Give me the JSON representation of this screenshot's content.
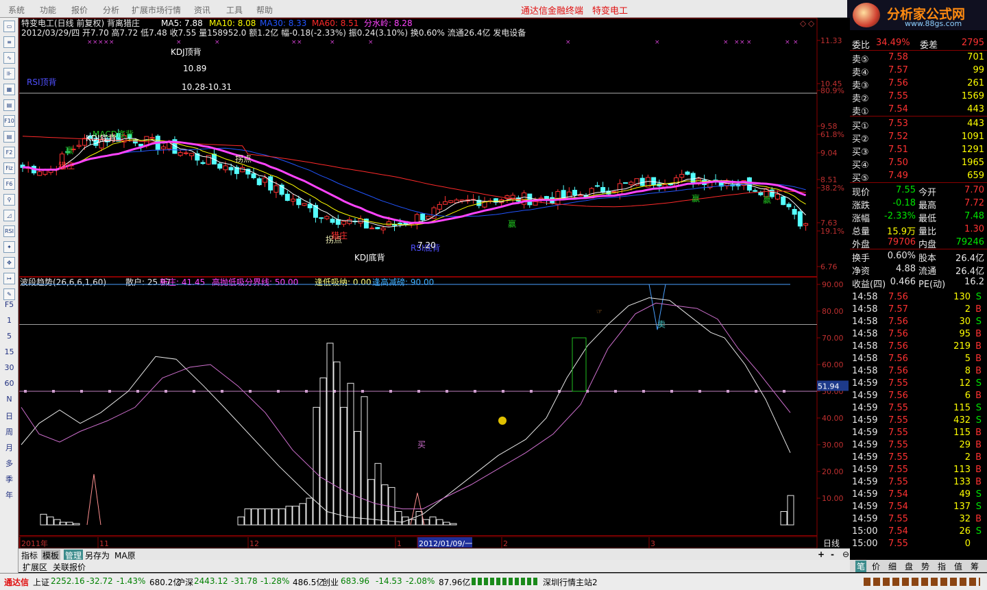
{
  "menu": {
    "items": [
      "系统",
      "功能",
      "报价",
      "分析",
      "扩展市场行情",
      "资讯",
      "工具",
      "帮助"
    ],
    "title": "通达信金融终端",
    "stock_title": "特变电工"
  },
  "logo": {
    "name": "分析家公式网",
    "url": "www.88gs.com"
  },
  "toolbar": {
    "icons": [
      "chart-icon",
      "list-icon",
      "line-icon",
      "candle-icon",
      "grid-icon",
      "report-icon",
      "f10-icon",
      "doc-icon",
      "f-icon",
      "fiz-icon",
      "f6-icon",
      "search-icon",
      "kline-icon",
      "rsi-icon",
      "tool-icon",
      "move-icon",
      "arrow-icon",
      "pen-icon"
    ],
    "f_labels": [
      "F5",
      "1",
      "5",
      "15",
      "30",
      "60",
      "N",
      "日",
      "周",
      "月",
      "多",
      "季",
      "年"
    ]
  },
  "main_chart": {
    "header1": "特变电工(日线 前复权) 背离猎庄",
    "ma5": "MA5: 7.88",
    "ma10": "MA10: 8.08",
    "ma30": "MA30: 8.33",
    "ma60": "MA60: 8.51",
    "fsl": "分水岭: 8.28",
    "header2": "2012/03/29/四 开7.70 高7.72 低7.48 收7.55 量158952.0 额1.2亿 幅-0.18(-2.33%) 振0.24(3.10%) 换0.60% 流通26.4亿 发电设备",
    "price_axis": [
      "11.33",
      "10.45",
      "80.9%",
      "9.58",
      "61.8%",
      "9.04",
      "8.51",
      "38.2%",
      "7.63",
      "19.1%",
      "6.76"
    ],
    "annotations": [
      "RSI顶背",
      "KDJ顶背",
      "10.89",
      "10.28-10.31",
      "MACD底背",
      "KDJ底背",
      "赢",
      "猎庄",
      "拐点",
      "拐点",
      "猎庄",
      "KDJ底背",
      "RSI底背",
      "7.20",
      "赢",
      "赢",
      "赢"
    ]
  },
  "sub_chart": {
    "title": "波段趋势(26,6,6,1,60)",
    "sanhu": "散户: 25.97",
    "xinzhuang": "新庄: 41.45",
    "gaopao": "高抛低吸分界线: 50.00",
    "fengdi": "逢低吸纳: 0.00",
    "fenggao": "逢高减磅: 90.00",
    "axis": [
      "90.00",
      "80.00",
      "70.00",
      "60.00",
      "50.00",
      "40.00",
      "30.00",
      "20.00",
      "10.00"
    ],
    "current": "51.94",
    "buy_label": "买",
    "sell_label": "卖",
    "x_labels": [
      "2011年",
      "11",
      "12",
      "1",
      "2012/01/09/一",
      "2",
      "3"
    ],
    "period": "日线"
  },
  "quote": {
    "weibi_label": "委比",
    "weibi_value": "34.49%",
    "weicha_label": "委差",
    "weicha_value": "2795",
    "sells": [
      {
        "label": "卖⑤",
        "price": "7.58",
        "vol": "701"
      },
      {
        "label": "卖④",
        "price": "7.57",
        "vol": "99"
      },
      {
        "label": "卖③",
        "price": "7.56",
        "vol": "261"
      },
      {
        "label": "卖②",
        "price": "7.55",
        "vol": "1569"
      },
      {
        "label": "卖①",
        "price": "7.54",
        "vol": "443"
      }
    ],
    "buys": [
      {
        "label": "买①",
        "price": "7.53",
        "vol": "443"
      },
      {
        "label": "买②",
        "price": "7.52",
        "vol": "1091"
      },
      {
        "label": "买③",
        "price": "7.51",
        "vol": "1291"
      },
      {
        "label": "买④",
        "price": "7.50",
        "vol": "1965"
      },
      {
        "label": "买⑤",
        "price": "7.49",
        "vol": "659"
      }
    ],
    "stats": [
      {
        "l1": "现价",
        "v1": "7.55",
        "l2": "今开",
        "v2": "7.70",
        "c1": "grn",
        "c2": "red"
      },
      {
        "l1": "涨跌",
        "v1": "-0.18",
        "l2": "最高",
        "v2": "7.72",
        "c1": "grn",
        "c2": "red"
      },
      {
        "l1": "涨幅",
        "v1": "-2.33%",
        "l2": "最低",
        "v2": "7.48",
        "c1": "grn",
        "c2": "grn"
      },
      {
        "l1": "总量",
        "v1": "15.9万",
        "l2": "量比",
        "v2": "1.30",
        "c1": "yel",
        "c2": "red"
      },
      {
        "l1": "外盘",
        "v1": "79706",
        "l2": "内盘",
        "v2": "79246",
        "c1": "red",
        "c2": "grn"
      },
      {
        "l1": "换手",
        "v1": "0.60%",
        "l2": "股本",
        "v2": "26.4亿",
        "c1": "wht",
        "c2": "wht"
      },
      {
        "l1": "净资",
        "v1": "4.88",
        "l2": "流通",
        "v2": "26.4亿",
        "c1": "wht",
        "c2": "wht"
      },
      {
        "l1": "收益(四)",
        "v1": "0.466",
        "l2": "PE(动)",
        "v2": "16.2",
        "c1": "wht",
        "c2": "wht"
      }
    ]
  },
  "ticks": [
    {
      "t": "14:58",
      "p": "7.56",
      "v": "130",
      "d": "S"
    },
    {
      "t": "14:58",
      "p": "7.57",
      "v": "2",
      "d": "B"
    },
    {
      "t": "14:58",
      "p": "7.56",
      "v": "30",
      "d": "S"
    },
    {
      "t": "14:58",
      "p": "7.56",
      "v": "95",
      "d": "B"
    },
    {
      "t": "14:58",
      "p": "7.56",
      "v": "219",
      "d": "B"
    },
    {
      "t": "14:58",
      "p": "7.56",
      "v": "5",
      "d": "B"
    },
    {
      "t": "14:58",
      "p": "7.56",
      "v": "8",
      "d": "B"
    },
    {
      "t": "14:59",
      "p": "7.55",
      "v": "12",
      "d": "S"
    },
    {
      "t": "14:59",
      "p": "7.56",
      "v": "6",
      "d": "B"
    },
    {
      "t": "14:59",
      "p": "7.55",
      "v": "115",
      "d": "S"
    },
    {
      "t": "14:59",
      "p": "7.55",
      "v": "432",
      "d": "S"
    },
    {
      "t": "14:59",
      "p": "7.55",
      "v": "115",
      "d": "B"
    },
    {
      "t": "14:59",
      "p": "7.55",
      "v": "29",
      "d": "B"
    },
    {
      "t": "14:59",
      "p": "7.55",
      "v": "2",
      "d": "B"
    },
    {
      "t": "14:59",
      "p": "7.55",
      "v": "113",
      "d": "B"
    },
    {
      "t": "14:59",
      "p": "7.55",
      "v": "133",
      "d": "B"
    },
    {
      "t": "14:59",
      "p": "7.54",
      "v": "49",
      "d": "S"
    },
    {
      "t": "14:59",
      "p": "7.54",
      "v": "137",
      "d": "S"
    },
    {
      "t": "14:59",
      "p": "7.55",
      "v": "32",
      "d": "B"
    },
    {
      "t": "15:00",
      "p": "7.54",
      "v": "26",
      "d": "S"
    },
    {
      "t": "15:00",
      "p": "7.55",
      "v": "0",
      "d": ""
    }
  ],
  "bottom_tabs": [
    "指标",
    "模板",
    "管理",
    "另存为",
    "MA原"
  ],
  "ext_tabs": [
    "扩展区",
    "关联报价"
  ],
  "right_tabs": [
    "笔",
    "价",
    "细",
    "盘",
    "势",
    "指",
    "值",
    "筹"
  ],
  "status": {
    "brand": "通达信",
    "sh_label": "上证",
    "sh_value": "2252.16",
    "sh_chg": "-32.72",
    "sh_pct": "-1.43%",
    "sh_amt": "680.2亿",
    "sz_label": "沪深",
    "sz_value": "2443.12",
    "sz_chg": "-31.78",
    "sz_pct": "-1.28%",
    "sz_amt": "486.5亿",
    "cy_label": "创业",
    "cy_value": "683.96",
    "cy_chg": "-14.53",
    "cy_pct": "-2.08%",
    "cy_amt": "87.96亿",
    "server": "深圳行情主站2"
  },
  "colors": {
    "ma5": "#ffffff",
    "ma10": "#ffff00",
    "ma30": "#2255ff",
    "ma60": "#ff2a2a",
    "fsl": "#ff44ff",
    "up": "#ff3232",
    "down": "#54ffff",
    "grid": "#8b0000"
  }
}
